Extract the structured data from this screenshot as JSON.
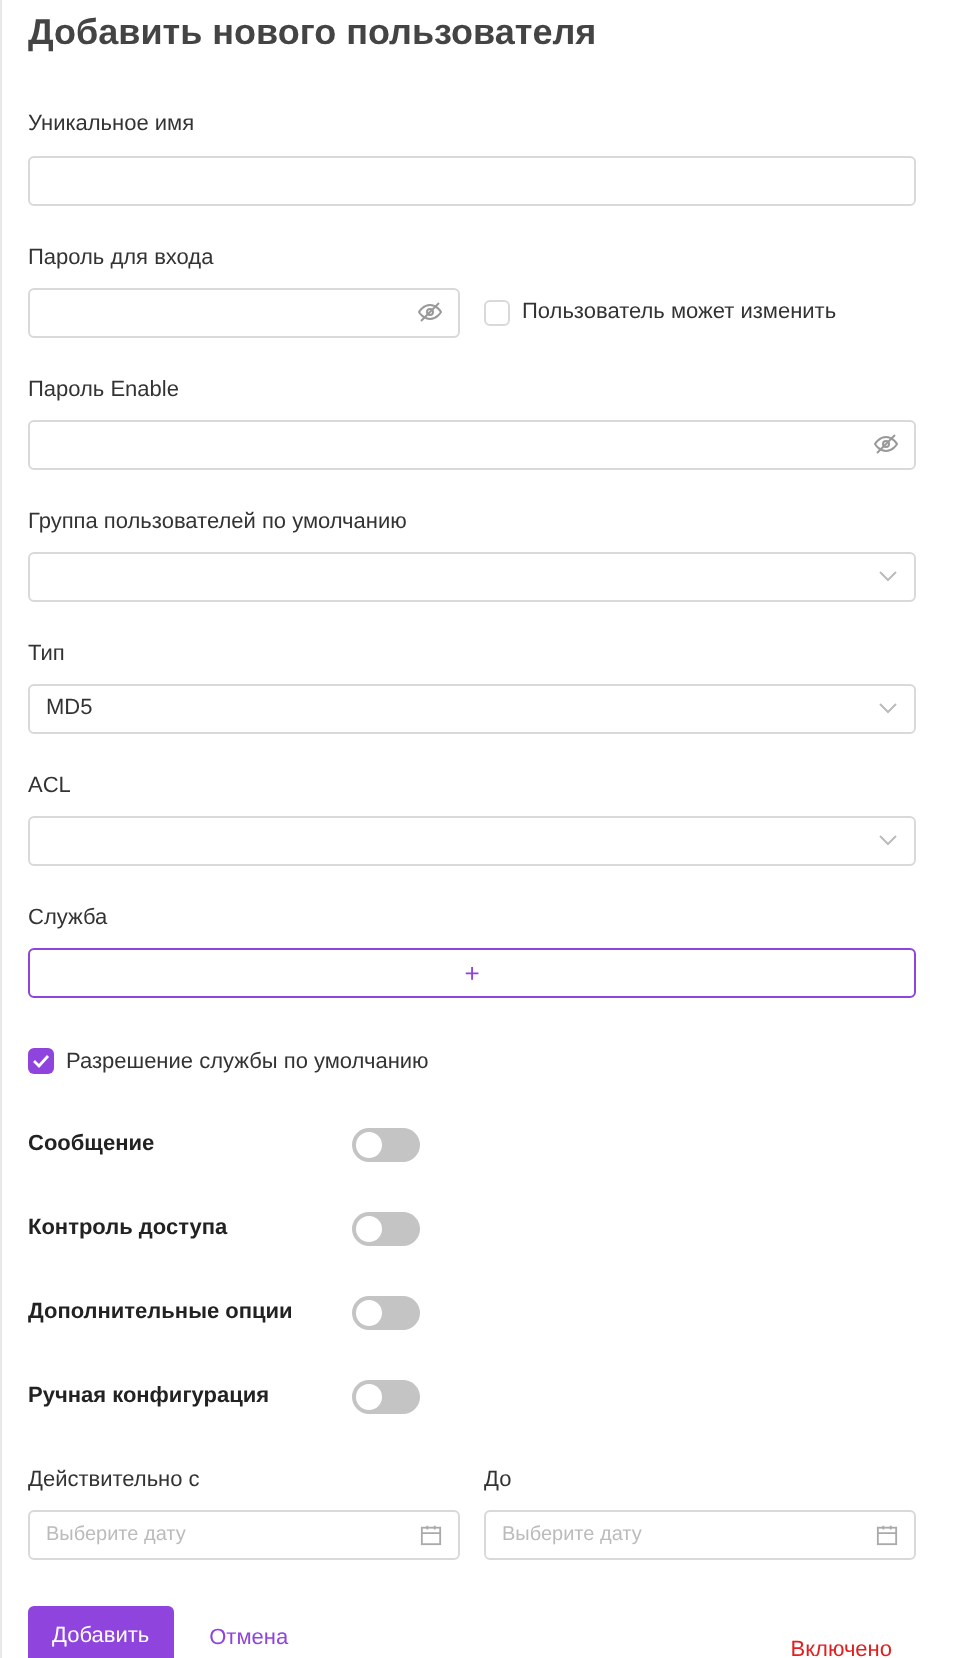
{
  "title": "Добавить нового пользователя",
  "fields": [
    {
      "kind": "text",
      "label": "Уникальное имя"
    },
    {
      "kind": "password",
      "label": "Пароль для входа",
      "checkbox": {
        "label": "Пользователь может изменить",
        "checked": false
      }
    },
    {
      "kind": "password",
      "label": "Пароль Enable"
    },
    {
      "kind": "select",
      "label": "Группа пользователей по умолчанию"
    },
    {
      "kind": "select",
      "label": "Тип",
      "value": "MD5"
    },
    {
      "kind": "select",
      "label": "ACL"
    },
    {
      "kind": "add",
      "label": "Служба",
      "button": "+"
    }
  ],
  "default_permission": {
    "label": "Разрешение службы по умолчанию",
    "checked": true
  },
  "toggles": [
    {
      "label": "Сообщение",
      "on": false
    },
    {
      "label": "Контроль доступа",
      "on": false
    },
    {
      "label": "Дополнительные опции",
      "on": false
    },
    {
      "label": "Ручная конфигурация",
      "on": false
    }
  ],
  "dates": [
    {
      "label": "Действительно с",
      "placeholder": "Выберите дату"
    },
    {
      "label": "До",
      "placeholder": "Выберите дату"
    }
  ],
  "submit": "Добавить",
  "cancel": "Отмена",
  "status": "Включено"
}
